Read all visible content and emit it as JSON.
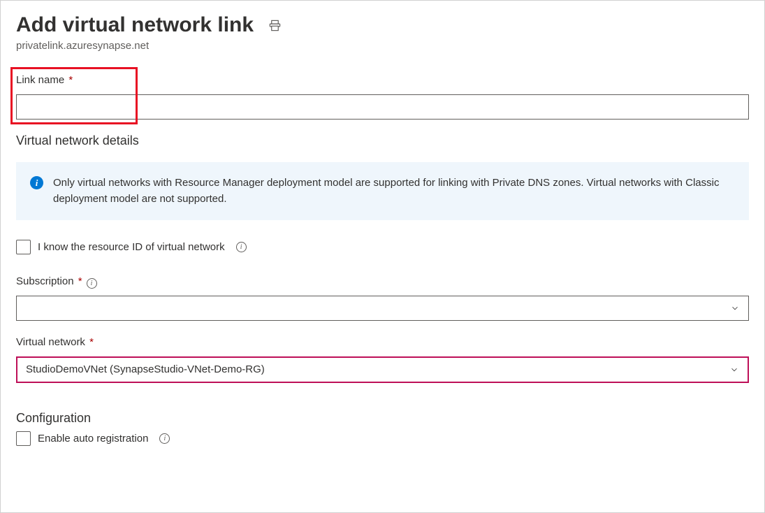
{
  "header": {
    "title": "Add virtual network link",
    "subtitle": "privatelink.azuresynapse.net"
  },
  "form": {
    "link_name": {
      "label": "Link name",
      "value": ""
    },
    "vnet_details_heading": "Virtual network details",
    "info_message": "Only virtual networks with Resource Manager deployment model are supported for linking with Private DNS zones. Virtual networks with Classic deployment model are not supported.",
    "know_resource_id": {
      "label": "I know the resource ID of virtual network",
      "checked": false
    },
    "subscription": {
      "label": "Subscription",
      "value": ""
    },
    "virtual_network": {
      "label": "Virtual network",
      "value": "StudioDemoVNet (SynapseStudio-VNet-Demo-RG)"
    },
    "configuration_heading": "Configuration",
    "auto_registration": {
      "label": "Enable auto registration",
      "checked": false
    }
  }
}
